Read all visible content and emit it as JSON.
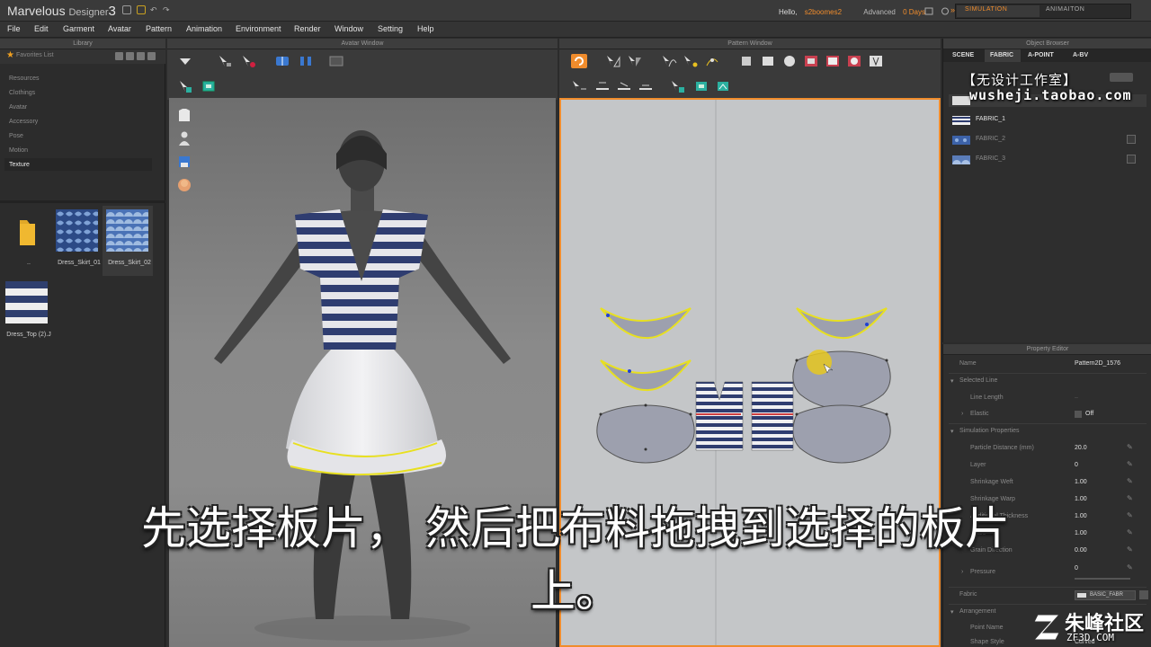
{
  "app": {
    "name_main": "Marvelous",
    "name_sub": "Designer",
    "version": "3",
    "hello": "Hello,",
    "user": "s2boomes2",
    "plan": "Advanced",
    "days": "0 Days",
    "modes": {
      "simulation": "SIMULATION",
      "animation": "ANIMAITON"
    }
  },
  "menu": [
    "File",
    "Edit",
    "Garment",
    "Avatar",
    "Pattern",
    "Animation",
    "Environment",
    "Render",
    "Window",
    "Setting",
    "Help"
  ],
  "library": {
    "header": "Library",
    "favorites": "Favorites List",
    "categories": [
      "Resources",
      "Clothings",
      "Avatar",
      "Accessory",
      "Pose",
      "Motion",
      "Texture"
    ],
    "selected_category": "Texture",
    "thumbnails": [
      {
        "label": "..",
        "kind": "folder"
      },
      {
        "label": "Dress_Skirt_01",
        "kind": "pattern-blue"
      },
      {
        "label": "Dress_Skirt_02",
        "kind": "pattern-light"
      },
      {
        "label": "Dress_Top (2).J",
        "kind": "stripe"
      }
    ]
  },
  "avatar_window": {
    "header": "Avatar Window"
  },
  "pattern_window": {
    "header": "Pattern Window"
  },
  "object_browser": {
    "header": "Object Browser",
    "tabs": [
      "SCENE",
      "FABRIC",
      "A-POINT",
      "A-BV"
    ],
    "active_tab": "FABRIC",
    "fabrics": [
      {
        "name": "FABRIC_1",
        "swatch": "stripe",
        "checked": false
      },
      {
        "name": "FABRIC_2",
        "swatch": "blue",
        "checked": true
      },
      {
        "name": "FABRIC_3",
        "swatch": "blue",
        "checked": true
      }
    ]
  },
  "property_editor": {
    "header": "Property Editor",
    "rows": [
      {
        "label": "Name",
        "value": "Pattern2D_1576",
        "indent": 0
      },
      {
        "label": "Selected Line",
        "value": "",
        "indent": 0,
        "section": true
      },
      {
        "label": "Line Length",
        "value": "",
        "indent": 1
      },
      {
        "label": "Elastic",
        "value": "Off",
        "indent": 1,
        "toggle": true
      },
      {
        "label": "Simulation Properties",
        "value": "",
        "indent": 0,
        "section": true
      },
      {
        "label": "Particle Distance (mm)",
        "value": "20.0",
        "indent": 1
      },
      {
        "label": "Layer",
        "value": "0",
        "indent": 1
      },
      {
        "label": "Shrinkage Weft",
        "value": "1.00",
        "indent": 1
      },
      {
        "label": "Shrinkage Warp",
        "value": "1.00",
        "indent": 1
      },
      {
        "label": "Additional Thickness",
        "value": "1.00",
        "indent": 1
      },
      {
        "label": "Scale",
        "value": "1.00",
        "indent": 1
      },
      {
        "label": "Grain Direction",
        "value": "0.00",
        "indent": 1
      },
      {
        "label": "Pressure",
        "value": "0",
        "indent": 1
      },
      {
        "label": "Fabric",
        "value": "BASIC_FABR",
        "indent": 0
      },
      {
        "label": "Arrangement",
        "value": "",
        "indent": 0,
        "section": true
      },
      {
        "label": "Point Name",
        "value": "",
        "indent": 1
      },
      {
        "label": "Shape Style",
        "value": "Curved",
        "indent": 1
      }
    ]
  },
  "overlay": {
    "studio_watermark": "【无设计工作室】",
    "studio_url": "wusheji.taobao.com",
    "subtitle_line1": "先选择板片， 然后把布料拖拽到选择的板片",
    "subtitle_line2": "上。",
    "logo_text": "朱峰社区",
    "logo_url": "ZF3D.COM"
  },
  "colors": {
    "accent": "#f08c2c",
    "stripe_navy": "#2f3f6e",
    "selection_yellow": "#e8e020",
    "piece_fill": "#9da0ae"
  }
}
